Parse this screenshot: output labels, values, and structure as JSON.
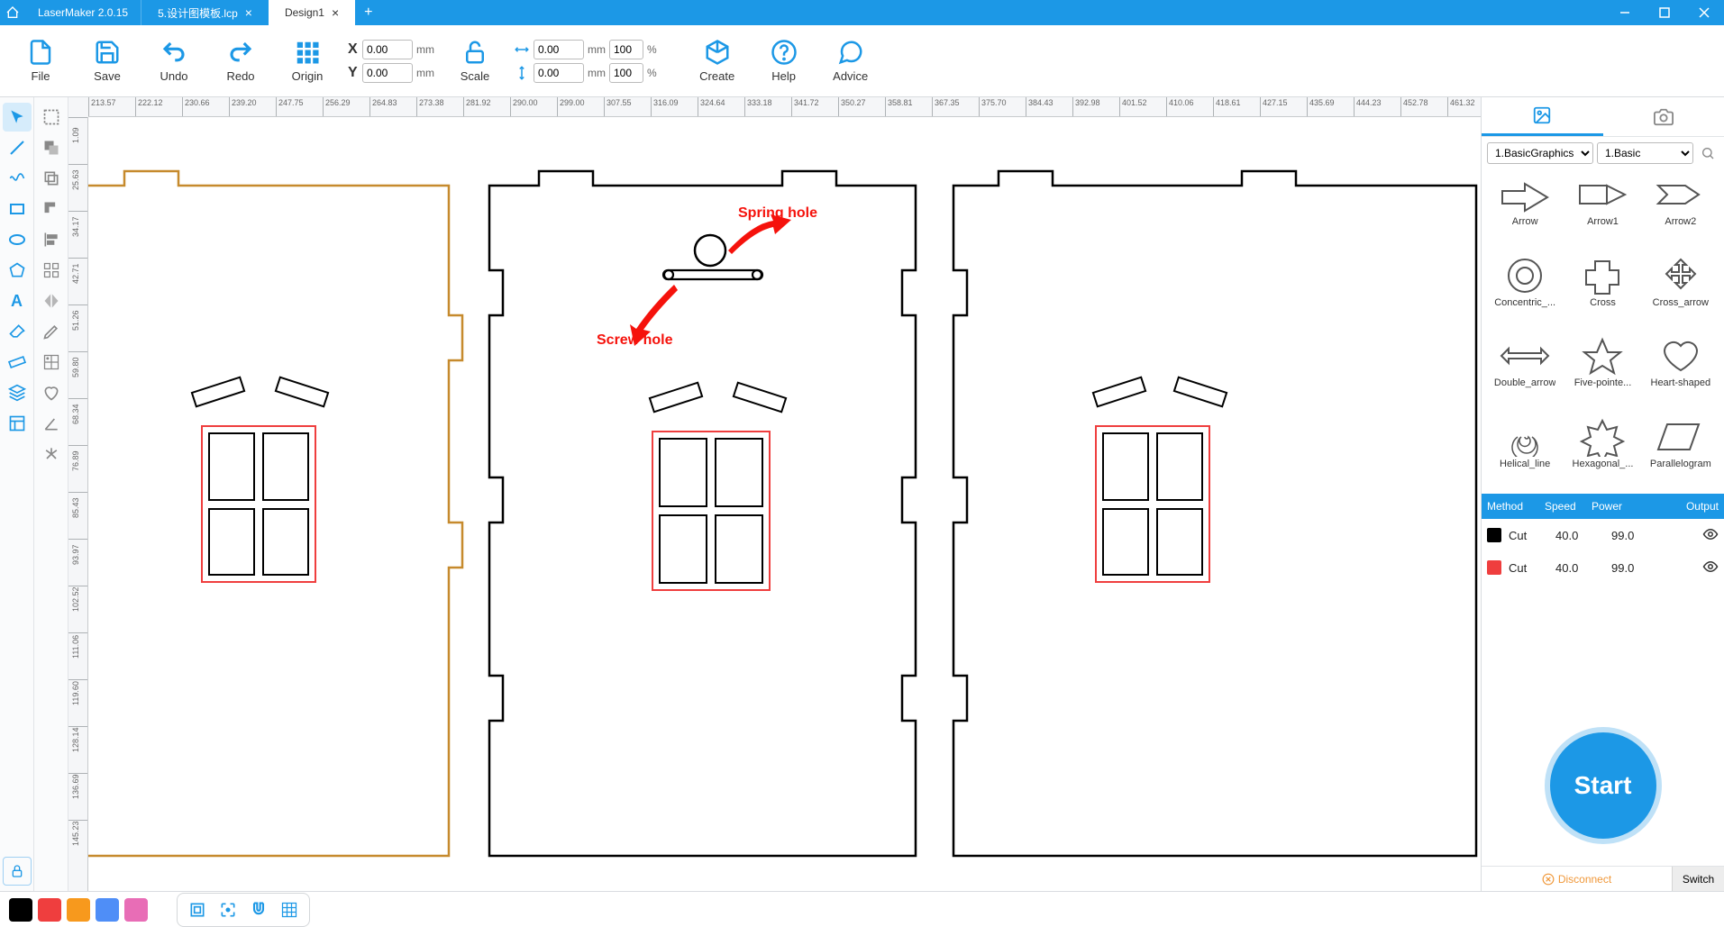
{
  "app": {
    "name": "LaserMaker 2.0.15"
  },
  "tabs": [
    {
      "label": "5.设计图模板.lcp",
      "active": false
    },
    {
      "label": "Design1",
      "active": true
    }
  ],
  "toolbar": {
    "file": "File",
    "save": "Save",
    "undo": "Undo",
    "redo": "Redo",
    "origin": "Origin",
    "scale": "Scale",
    "create": "Create",
    "help": "Help",
    "advice": "Advice",
    "x_label": "X",
    "y_label": "Y",
    "x_val": "0.00",
    "y_val": "0.00",
    "unit": "mm",
    "w_val": "0.00",
    "h_val": "0.00",
    "w_pct": "100",
    "h_pct": "100",
    "pct": "%"
  },
  "ruler": {
    "unit": "mm",
    "h_ticks": [
      "213.57",
      "222.12",
      "230.66",
      "239.20",
      "247.75",
      "256.29",
      "264.83",
      "273.38",
      "281.92",
      "290.00",
      "299.00",
      "307.55",
      "316.09",
      "324.64",
      "333.18",
      "341.72",
      "350.27",
      "358.81",
      "367.35",
      "375.70",
      "384.43",
      "392.98",
      "401.52",
      "410.06",
      "418.61",
      "427.15",
      "435.69",
      "444.23",
      "452.78",
      "461.32"
    ],
    "v_ticks": [
      "1.09",
      "25.63",
      "34.17",
      "42.71",
      "51.26",
      "59.80",
      "68.34",
      "76.89",
      "85.43",
      "93.97",
      "102.52",
      "111.06",
      "119.60",
      "128.14",
      "136.69",
      "145.23"
    ]
  },
  "annotations": {
    "spring": "Spring hole",
    "screw": "Screw hole"
  },
  "right": {
    "cat1": "1.BasicGraphics",
    "cat2": "1.Basic",
    "shapes": [
      "Arrow",
      "Arrow1",
      "Arrow2",
      "Concentric_...",
      "Cross",
      "Cross_arrow",
      "Double_arrow",
      "Five-pointe...",
      "Heart-shaped",
      "Helical_line",
      "Hexagonal_...",
      "Parallelogram"
    ],
    "layer_head": {
      "method": "Method",
      "speed": "Speed",
      "power": "Power",
      "output": "Output"
    },
    "layers": [
      {
        "color": "#000000",
        "method": "Cut",
        "speed": "40.0",
        "power": "99.0"
      },
      {
        "color": "#ef3e3e",
        "method": "Cut",
        "speed": "40.0",
        "power": "99.0"
      }
    ],
    "start": "Start",
    "disconnect": "Disconnect",
    "switch": "Switch"
  },
  "palette": [
    "#000000",
    "#ef3e3e",
    "#f7991d",
    "#4f8ef7",
    "#e86db6"
  ]
}
